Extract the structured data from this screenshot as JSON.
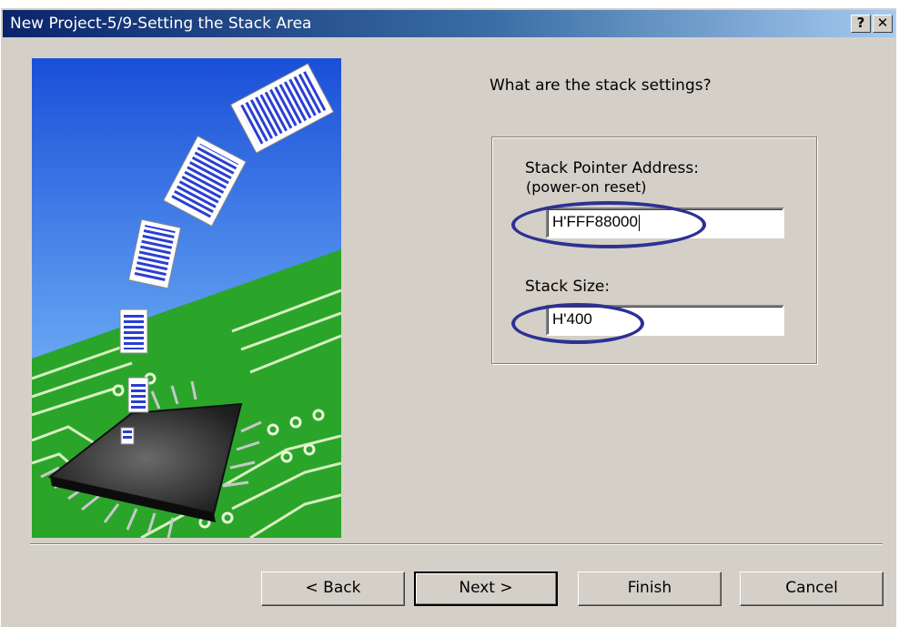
{
  "window": {
    "title": "New Project-5/9-Setting the Stack Area",
    "help_label": "?",
    "close_label": "✕"
  },
  "wizard": {
    "question": "What are the stack settings?",
    "stack_pointer_label": "Stack Pointer Address:",
    "stack_pointer_sublabel": "(power-on reset)",
    "stack_pointer_value": "H'FFF88000",
    "stack_size_label": "Stack Size:",
    "stack_size_value": "H'400"
  },
  "buttons": {
    "back": "< Back",
    "next": "Next >",
    "finish": "Finish",
    "cancel": "Cancel"
  },
  "colors": {
    "titlebar_start": "#0a246a",
    "titlebar_end": "#a6caf0",
    "dialog_face": "#d4d0c8",
    "highlight_oval": "#2e3192"
  },
  "illustration": {
    "icon": "documents-into-chip-illustration"
  }
}
